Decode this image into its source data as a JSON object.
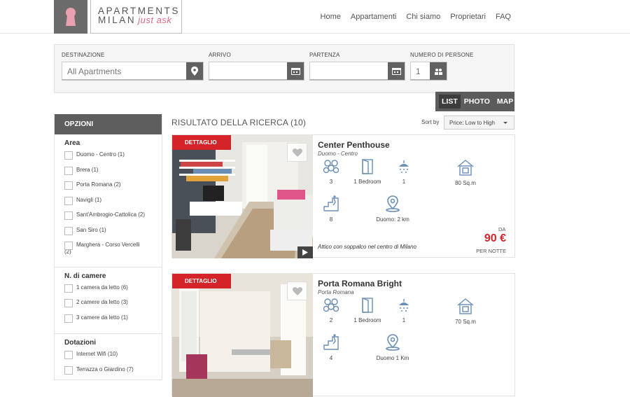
{
  "logo": {
    "line1": "APARTMENTS",
    "line2": "MILAN",
    "tagline": "just ask"
  },
  "nav": [
    "Home",
    "Appartamenti",
    "Chi siamo",
    "Proprietari",
    "FAQ"
  ],
  "search": {
    "destination_label": "DESTINAZIONE",
    "destination_value": "All Apartments",
    "arrival_label": "ARRIVO",
    "arrival_value": "",
    "departure_label": "PARTENZA",
    "departure_value": "",
    "persons_label": "NUMERO DI PERSONE",
    "persons_value": "1"
  },
  "views": {
    "list": "LIST",
    "photo": "PHOTO",
    "map": "MAP"
  },
  "sidebar": {
    "title": "OPZIONI",
    "area_title": "Area",
    "area_options": [
      "Duomo - Centro (1)",
      "Brera (1)",
      "Porta Romana (2)",
      "Navigli (1)",
      "Sant'Ambrogio-Cattolica (2)",
      "San Siro (1)",
      "Marghera - Corso Vercelli",
      "(2)"
    ],
    "rooms_title": "N. di camere",
    "rooms_options": [
      "1 camera da letto (6)",
      "2 camere da letto (3)",
      "3 camere da letto (1)"
    ],
    "amenities_title": "Dotazioni",
    "amenities_options": [
      "Internet Wifi (10)",
      "Terrazza o Giardino (7)"
    ]
  },
  "results": {
    "title": "RISULTATO DELLA RICERCA (10)",
    "sort_label": "Sort by",
    "sort_value": "Price: Low to High"
  },
  "listings": [
    {
      "badge": "DETTAGLIO",
      "name": "Center Penthouse",
      "area": "Duomo - Centro",
      "guests": "3",
      "bedrooms": "1 Bedroom",
      "bathrooms": "1",
      "size": "80 Sq.m",
      "floor": "8",
      "distance": "Duomo: 2 km",
      "description": "Attico con soppalco nel centro di Milano",
      "price_prefix": "DA",
      "price": "90 €",
      "price_suffix": "PER NOTTE"
    },
    {
      "badge": "DETTAGLIO",
      "name": "Porta Romana Bright",
      "area": "Porta Romana",
      "guests": "2",
      "bedrooms": "1 Bedroom",
      "bathrooms": "1",
      "size": "70 Sq.m",
      "floor": "4",
      "distance": "Duomo 1 Km"
    }
  ],
  "colors": {
    "accent": "#d4242a",
    "dark": "#5e5e5e",
    "logo_pink": "#d96a82"
  }
}
